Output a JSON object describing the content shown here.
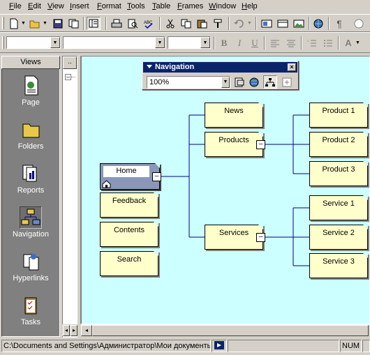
{
  "menubar": {
    "items": [
      {
        "label": "File",
        "ul": "F",
        "rest": "ile"
      },
      {
        "label": "Edit",
        "ul": "E",
        "rest": "dit"
      },
      {
        "label": "View",
        "ul": "V",
        "rest": "iew"
      },
      {
        "label": "Insert",
        "ul": "I",
        "rest": "nsert"
      },
      {
        "label": "Format",
        "ul": "F",
        "rest": "ormat"
      },
      {
        "label": "Tools",
        "ul": "T",
        "rest": "ools"
      },
      {
        "label": "Table",
        "ul": "T",
        "rest": "able"
      },
      {
        "label": "Frames",
        "ul": "F",
        "rest": "rames"
      },
      {
        "label": "Window",
        "ul": "W",
        "rest": "indow"
      },
      {
        "label": "Help",
        "ul": "H",
        "rest": "elp"
      }
    ]
  },
  "views": {
    "header": "Views",
    "items": [
      {
        "label": "Page",
        "icon": "page-icon"
      },
      {
        "label": "Folders",
        "icon": "folder-icon"
      },
      {
        "label": "Reports",
        "icon": "reports-icon"
      },
      {
        "label": "Navigation",
        "icon": "navigation-icon",
        "selected": true
      },
      {
        "label": "Hyperlinks",
        "icon": "hyperlinks-icon"
      },
      {
        "label": "Tasks",
        "icon": "tasks-icon"
      }
    ]
  },
  "folder_col": {
    "button": ".."
  },
  "navigation_toolbar": {
    "title": "Navigation",
    "zoom": "100%"
  },
  "nodes": {
    "home": "Home",
    "feedback": "Feedback",
    "contents": "Contents",
    "search": "Search",
    "news": "News",
    "products": "Products",
    "services": "Services",
    "product1": "Product 1",
    "product2": "Product 2",
    "product3": "Product 3",
    "service1": "Service 1",
    "service2": "Service 2",
    "service3": "Service 3"
  },
  "statusbar": {
    "path": "C:\\Documents and Settings\\Администратор\\Мои документь",
    "num": "NUM"
  },
  "colors": {
    "canvas": "#ccffff",
    "node": "#ffffcc",
    "title_bar": "#0a246a",
    "connector": "#000080"
  }
}
